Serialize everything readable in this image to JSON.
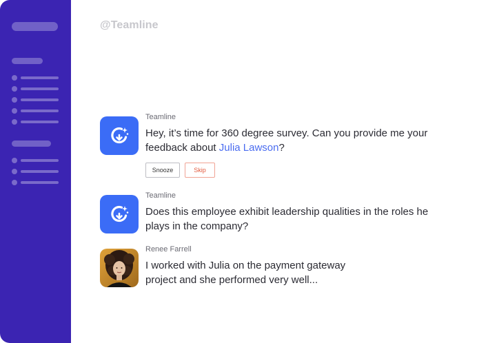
{
  "header": {
    "handle": "@Teamline"
  },
  "messages": [
    {
      "sender": "Teamline",
      "text_before": "Hey, it’s time for 360 degree survey. Can you provide me your feedback about ",
      "mention": "Julia Lawson",
      "text_after": "?",
      "actions": {
        "snooze": "Snooze",
        "skip": "Skip"
      }
    },
    {
      "sender": "Teamline",
      "text": "Does this employee exhibit leadership qualities in the roles he plays in the company?"
    },
    {
      "sender": "Renee Farrell",
      "text": "I worked with Julia on the payment gateway project and she performed very well..."
    }
  ],
  "colors": {
    "sidebar": "#3b24b2",
    "brand_blue": "#3b6cf6",
    "mention": "#4a6cf0",
    "skip": "#e35b3f"
  },
  "icons": {
    "bot_avatar": "teamline-logo-icon",
    "user_avatar": "user-photo"
  }
}
